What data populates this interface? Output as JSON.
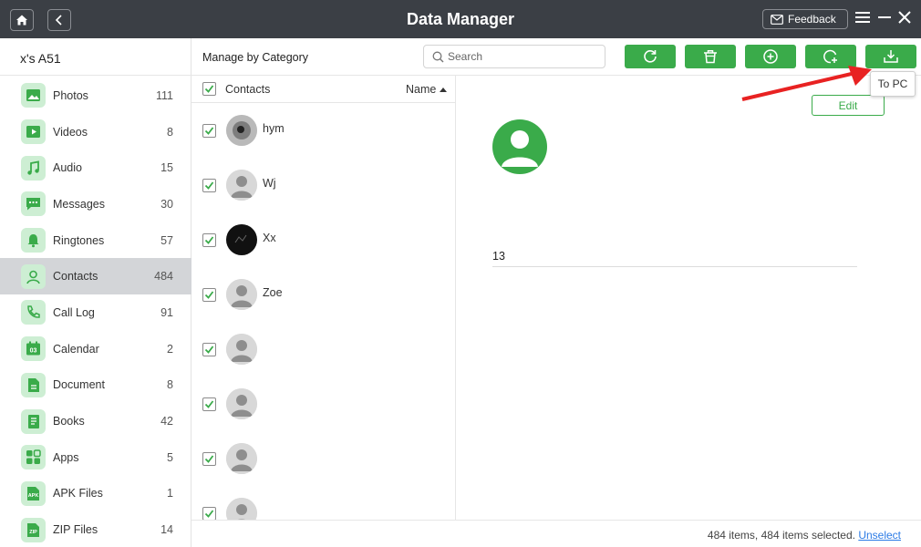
{
  "window": {
    "title": "Data Manager",
    "feedback_label": "Feedback"
  },
  "sidebar": {
    "device_name": "x's A51",
    "items": [
      {
        "label": "Photos",
        "count": "111",
        "icon": "photos-icon"
      },
      {
        "label": "Videos",
        "count": "8",
        "icon": "videos-icon"
      },
      {
        "label": "Audio",
        "count": "15",
        "icon": "audio-icon"
      },
      {
        "label": "Messages",
        "count": "30",
        "icon": "messages-icon"
      },
      {
        "label": "Ringtones",
        "count": "57",
        "icon": "ringtones-icon"
      },
      {
        "label": "Contacts",
        "count": "484",
        "icon": "contacts-icon",
        "active": true
      },
      {
        "label": "Call Log",
        "count": "91",
        "icon": "call-log-icon"
      },
      {
        "label": "Calendar",
        "count": "2",
        "icon": "calendar-icon",
        "glyph": "03"
      },
      {
        "label": "Document",
        "count": "8",
        "icon": "document-icon"
      },
      {
        "label": "Books",
        "count": "42",
        "icon": "books-icon"
      },
      {
        "label": "Apps",
        "count": "5",
        "icon": "apps-icon"
      },
      {
        "label": "APK Files",
        "count": "1",
        "icon": "apk-files-icon",
        "glyph": "APK"
      },
      {
        "label": "ZIP Files",
        "count": "14",
        "icon": "zip-files-icon",
        "glyph": "ZIP"
      }
    ]
  },
  "toolbar": {
    "heading": "Manage by Category",
    "search_placeholder": "Search",
    "search_value": "",
    "buttons": [
      "refresh-icon",
      "delete-icon",
      "add-icon",
      "add-to-device-icon",
      "to-pc-icon"
    ],
    "tooltip": "To PC"
  },
  "list": {
    "header_label": "Contacts",
    "sort_label": "Name",
    "rows": [
      {
        "name": "hym",
        "blurred": false,
        "avatar": "photo"
      },
      {
        "name": "Wj",
        "blurred": false,
        "avatar": "default"
      },
      {
        "name": "Xx",
        "blurred": false,
        "avatar": "dark"
      },
      {
        "name": "Zoe",
        "blurred": false,
        "avatar": "default"
      },
      {
        "name": "",
        "blurred": true,
        "avatar": "default"
      },
      {
        "name": "",
        "blurred": true,
        "avatar": "default"
      },
      {
        "name": "",
        "blurred": true,
        "avatar": "default"
      },
      {
        "name": "",
        "blurred": true,
        "avatar": "default"
      }
    ]
  },
  "detail": {
    "edit_label": "Edit",
    "name": "",
    "phone_prefix": "13",
    "phone_rest": ""
  },
  "status": {
    "text": "484 items, 484 items selected.",
    "unselect_label": "Unselect"
  },
  "colors": {
    "accent": "#3aab4a",
    "titlebar": "#3b3f45",
    "sidebar_active": "#d3d5d8",
    "annotation_arrow": "#e82222"
  }
}
